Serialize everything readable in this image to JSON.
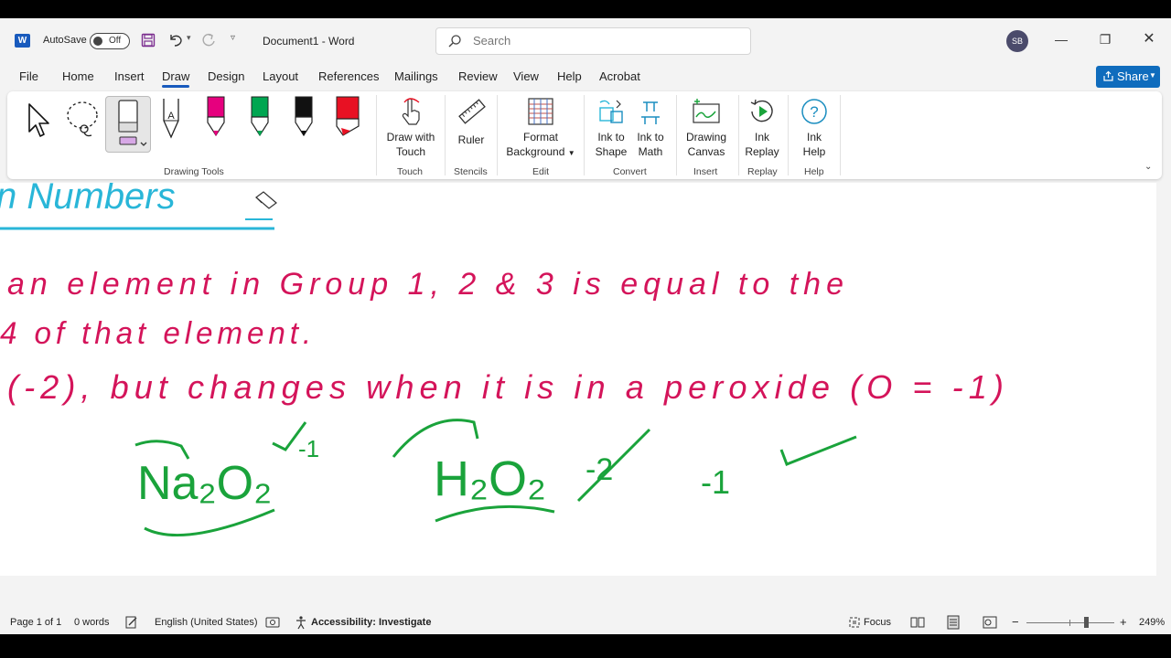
{
  "window": {
    "autosave_label": "AutoSave",
    "autosave_state": "Off",
    "doc_title": "Document1  -  Word",
    "search_placeholder": "Search",
    "user_initials": "SB",
    "app_letter": "W"
  },
  "tabs": [
    "File",
    "Home",
    "Insert",
    "Draw",
    "Design",
    "Layout",
    "References",
    "Mailings",
    "Review",
    "View",
    "Help",
    "Acrobat"
  ],
  "active_tab": "Draw",
  "share_label": "Share",
  "ribbon": {
    "drawing_tools_label": "Drawing Tools",
    "pen_colors": [
      "#000000",
      "#e6007e",
      "#00a651",
      "#111111",
      "#e81123"
    ],
    "draw_touch": [
      "Draw with",
      "Touch"
    ],
    "touch_label": "Touch",
    "ruler": "Ruler",
    "stencils_label": "Stencils",
    "format_bg": [
      "Format",
      "Background"
    ],
    "edit_label": "Edit",
    "ink_shape": [
      "Ink to",
      "Shape"
    ],
    "ink_math": [
      "Ink to",
      "Math"
    ],
    "convert_label": "Convert",
    "drawing_canvas": [
      "Drawing",
      "Canvas"
    ],
    "insert_label": "Insert",
    "ink_replay": [
      "Ink",
      "Replay"
    ],
    "replay_label": "Replay",
    "ink_help": [
      "Ink",
      "Help"
    ],
    "help_label": "Help"
  },
  "ink": {
    "heading": "n  Numbers",
    "line1": "an element in Group 1, 2 & 3 is equal to the",
    "line2": "4  of that element.",
    "line3": "(-2), but changes when it is in a peroxide (O = -1)",
    "formula1": "Na₂O₂",
    "charge1": "-1",
    "formula2": "H₂O₂",
    "crossed": "-2",
    "charge2": "-1",
    "colors": {
      "pink": "#d4145a",
      "green": "#1aa33b",
      "cyan": "#29b6d8"
    }
  },
  "status": {
    "page": "Page 1 of 1",
    "words": "0 words",
    "language": "English (United States)",
    "accessibility": "Accessibility: Investigate",
    "focus": "Focus",
    "zoom": "249%",
    "zoom_out": "−",
    "zoom_in": "+"
  }
}
